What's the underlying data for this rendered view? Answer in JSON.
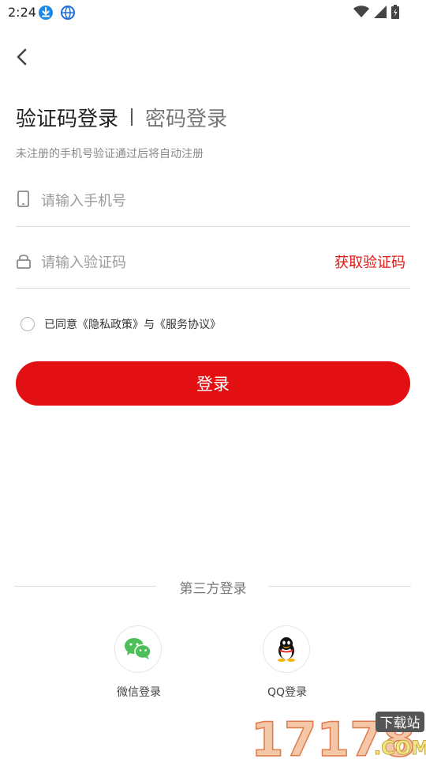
{
  "status_bar": {
    "time": "2:24"
  },
  "tabs": {
    "active": "验证码登录",
    "inactive": "密码登录"
  },
  "hint": "未注册的手机号验证通过后将自动注册",
  "phone_field": {
    "placeholder": "请输入手机号"
  },
  "code_field": {
    "placeholder": "请输入验证码",
    "get_code": "获取验证码"
  },
  "agreement": {
    "text": "已同意《隐私政策》与《服务协议》"
  },
  "login_button": "登录",
  "third_party": {
    "title": "第三方登录",
    "wechat_label": "微信登录",
    "qq_label": "QQ登录"
  },
  "watermark": {
    "number": "17178",
    "badge": "下载站",
    "suffix": ".COM"
  },
  "colors": {
    "accent": "#e31013",
    "get_code": "#e21717",
    "wechat": "#4cbf5a"
  }
}
